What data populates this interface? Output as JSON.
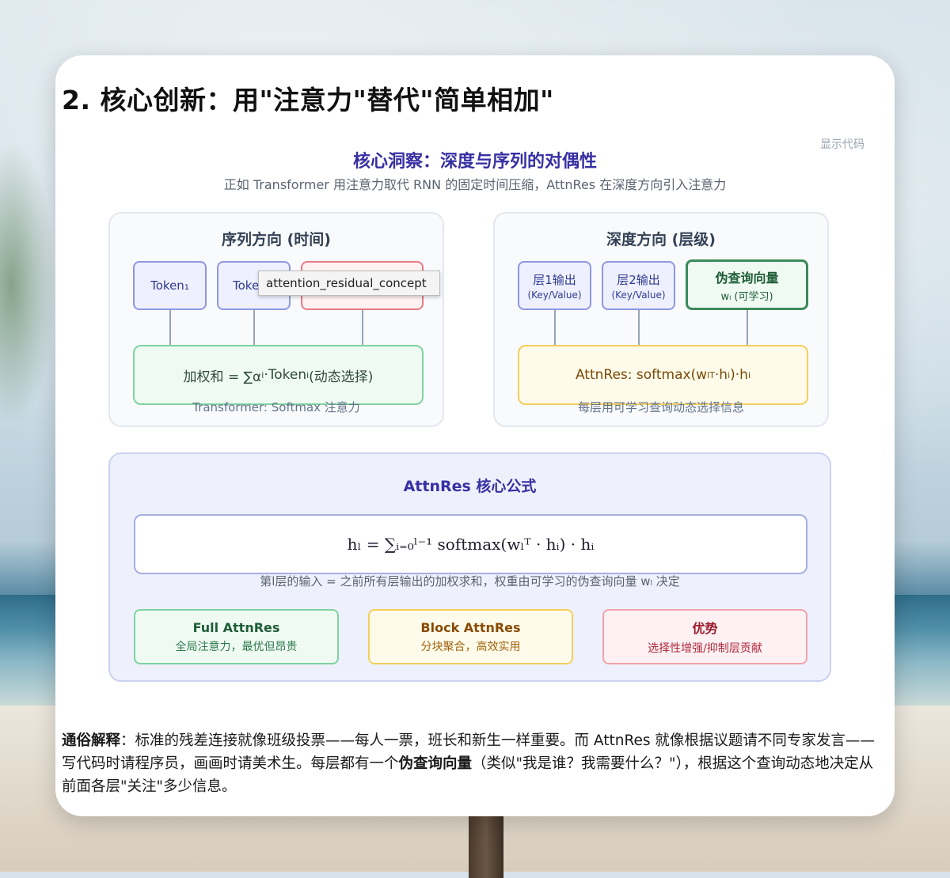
{
  "heading": "2. 核心创新：用\"注意力\"替代\"简单相加\"",
  "code_toggle": "显示代码",
  "insight": {
    "title": "核心洞察：深度与序列的对偶性",
    "subtitle": "正如 Transformer 用注意力取代 RNN 的固定时间压缩，AttnRes 在深度方向引入注意力"
  },
  "sequence_panel": {
    "title": "序列方向 (时间)",
    "token1": "Token₁",
    "token2": "Toke",
    "aggregate_prefix": "加权和 = ∑α",
    "aggregate_mid": "·Token",
    "aggregate_suffix": " (动态选择)",
    "sub_i": "i",
    "caption": "Transformer: Softmax 注意力"
  },
  "tooltip": "attention_residual_concept",
  "depth_panel": {
    "title": "深度方向 (层级)",
    "layer1_title": "层1输出",
    "layer1_sub": "(Key/Value)",
    "layer2_title": "层2输出",
    "layer2_sub": "(Key/Value)",
    "query_title": "伪查询向量",
    "query_sub": "wₗ (可学习)",
    "aggregate_prefix": "AttnRes: softmax(w",
    "aggregate_mid": "·h",
    "aggregate_end": ")·h",
    "sub_l": "l",
    "sup_T": "T",
    "sub_i": "i",
    "caption": "每层用可学习查询动态选择信息"
  },
  "formula": {
    "title": "AttnRes 核心公式",
    "expression": "hₗ = ∑ᵢ₌₀ˡ⁻¹ softmax(wₗᵀ · hᵢ) · hᵢ",
    "caption": "第l层的输入 = 之前所有层输出的加权求和，权重由可学习的伪查询向量 wₗ 决定"
  },
  "features": [
    {
      "title": "Full AttnRes",
      "desc": "全局注意力，最优但昂贵"
    },
    {
      "title": "Block AttnRes",
      "desc": "分块聚合，高效实用"
    },
    {
      "title": "优势",
      "desc": "选择性增强/抑制层贡献"
    }
  ],
  "explanation": {
    "label": "通俗解释",
    "part1": "：标准的残差连接就像班级投票——每人一票，班长和新生一样重要。而 AttnRes 就像根据议题请不同专家发言——写代码时请程序员，画画时请美术生。每层都有一个",
    "bold": "伪查询向量",
    "part2": "（类似\"我是谁？我需要什么？\"），根据这个查询动态地决定从前面各层\"关注\"多少信息。"
  }
}
